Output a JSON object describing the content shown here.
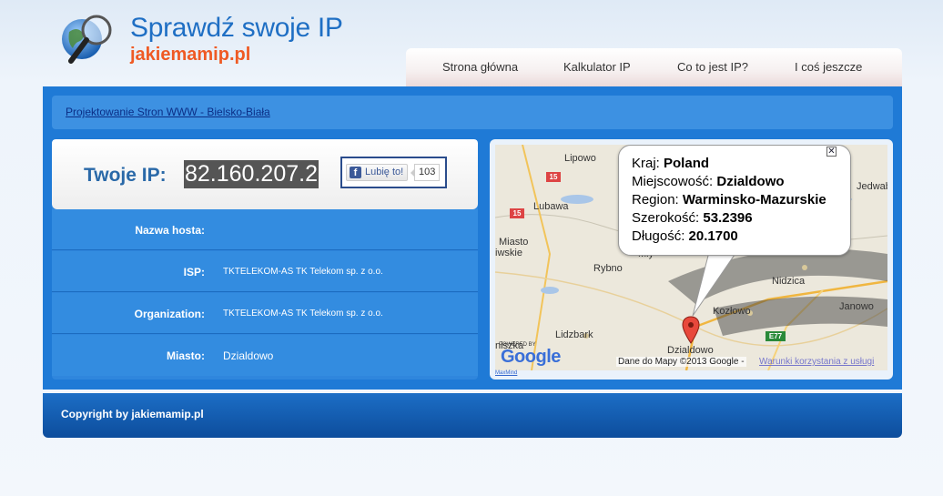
{
  "header": {
    "title": "Sprawdź swoje IP",
    "subtitle": "jakiemamip.pl"
  },
  "nav": {
    "items": [
      {
        "label": "Strona główna"
      },
      {
        "label": "Kalkulator IP"
      },
      {
        "label": "Co to jest IP?"
      },
      {
        "label": "I coś jeszcze"
      }
    ]
  },
  "promo_link": "Projektowanie Stron WWW - Bielsko-Biała",
  "ip": {
    "label": "Twoje IP:",
    "value": "82.160.207.2"
  },
  "facebook": {
    "like_label": "Lubię to!",
    "count": "103"
  },
  "details": [
    {
      "label": "Nazwa hosta:",
      "value": ""
    },
    {
      "label": "ISP:",
      "value": "TKTELEKOM-AS TK Telekom sp. z o.o."
    },
    {
      "label": "Organization:",
      "value": "TKTELEKOM-AS TK Telekom sp. z o.o."
    },
    {
      "label": "Miasto:",
      "value": "Dzialdowo"
    }
  ],
  "map": {
    "places": [
      "Lipowo",
      "Lubawa",
      "Miasto",
      "iwskie",
      "Rybno",
      "Nidzica",
      "Kozłowo",
      "Janowo",
      "Lidzbark",
      "Dzialdowo",
      "Jedwab",
      "Mły",
      "niszka"
    ],
    "roads": [
      "15",
      "15",
      "E77"
    ],
    "info": {
      "country_label": "Kraj:",
      "country": "Poland",
      "city_label": "Miejscowość:",
      "city": "Dzialdowo",
      "region_label": "Region:",
      "region": "Warminsko-Mazurskie",
      "lat_label": "Szerokość:",
      "lat": "53.2396",
      "lon_label": "Długość:",
      "lon": "20.1700"
    },
    "close_glyph": "✕",
    "powered_by": "POWERED BY",
    "google": "Google",
    "copyright": "Dane do Mapy ©2013 Google -",
    "terms_link": "Warunki korzystania z usługi",
    "maxmind": "MaxMind"
  },
  "footer": {
    "copyright": "Copyright by jakiemamip.pl"
  },
  "colors": {
    "brand_blue": "#1f7ad6",
    "accent_orange": "#ef5a24"
  }
}
